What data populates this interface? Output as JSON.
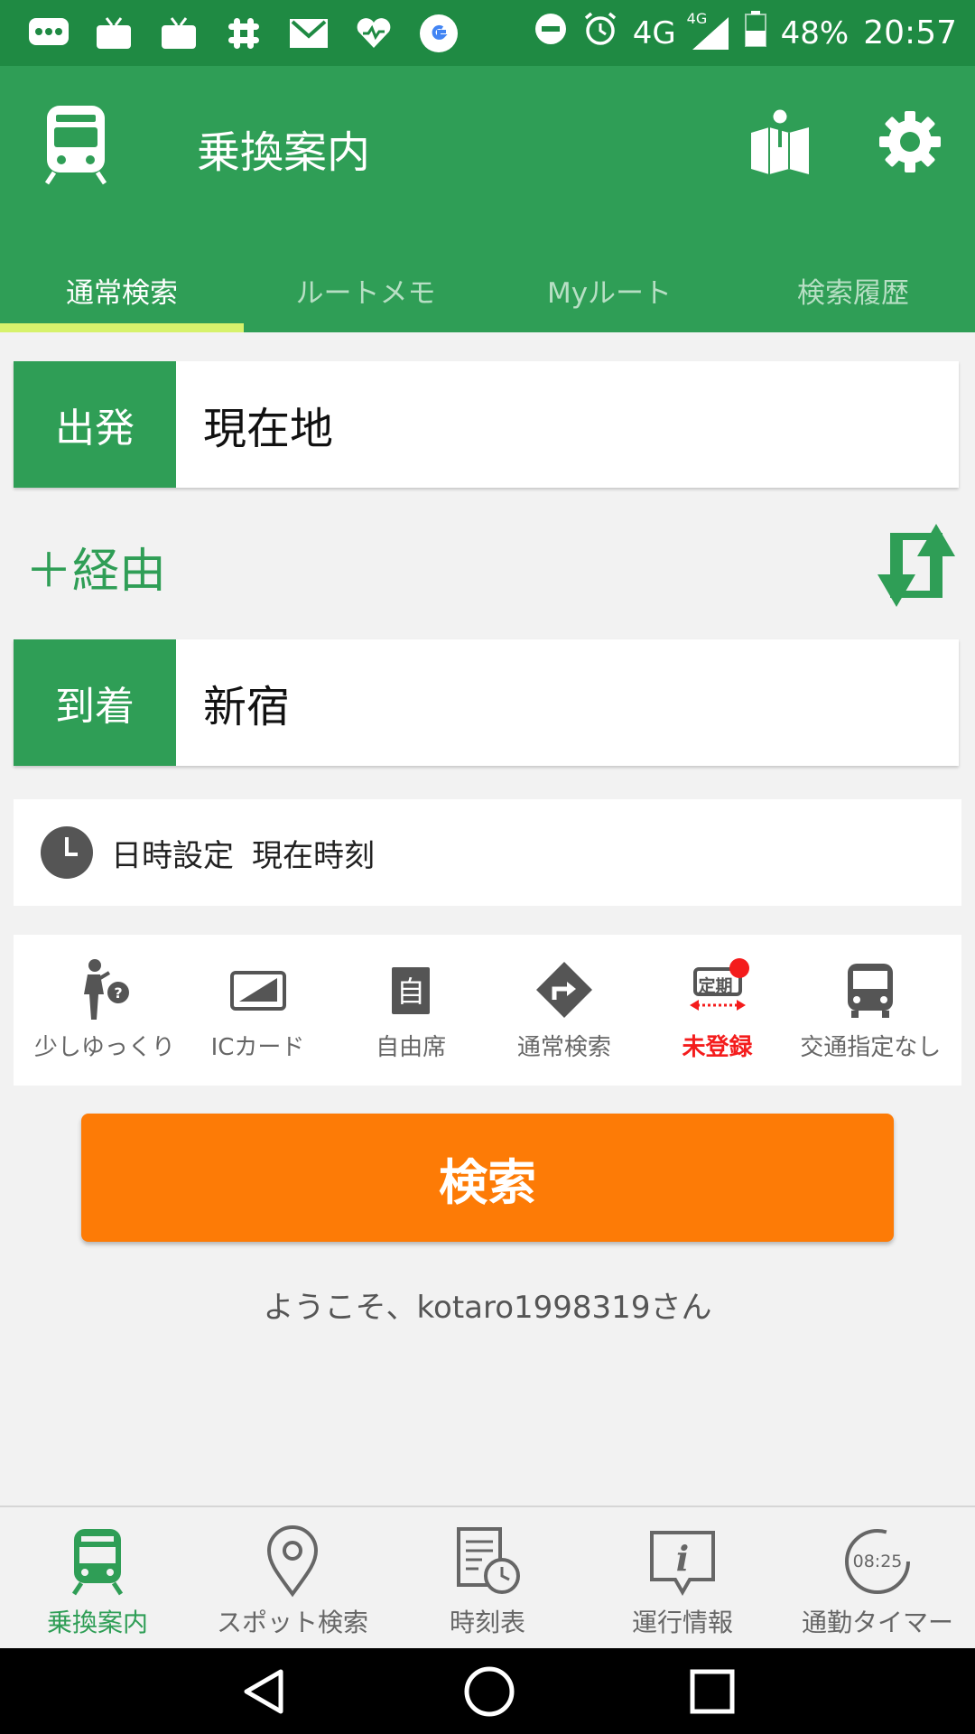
{
  "status_bar": {
    "network": "4G",
    "network_small": "4G",
    "battery": "48%",
    "time": "20:57",
    "icons": [
      "messages-icon",
      "tv-icon",
      "tv-icon",
      "slack-icon",
      "gmail-icon",
      "heart-icon",
      "google-icon",
      "dnd-icon",
      "alarm-icon",
      "signal-icon",
      "battery-icon"
    ]
  },
  "app_bar": {
    "title": "乗換案内",
    "tabs": [
      {
        "label": "通常検索",
        "active": true
      },
      {
        "label": "ルートメモ",
        "active": false
      },
      {
        "label": "Myルート",
        "active": false
      },
      {
        "label": "検索履歴",
        "active": false
      }
    ]
  },
  "form": {
    "departure_label": "出発",
    "departure_value": "現在地",
    "via_label": "＋経由",
    "arrival_label": "到着",
    "arrival_value": "新宿",
    "datetime_label": "日時設定",
    "datetime_value": "現在時刻"
  },
  "options": [
    {
      "label": "少しゆっくり",
      "icon": "walking-pace-icon"
    },
    {
      "label": "ICカード",
      "icon": "ic-card-icon"
    },
    {
      "label": "自由席",
      "icon": "seat-icon"
    },
    {
      "label": "通常検索",
      "icon": "route-direction-icon"
    },
    {
      "label": "未登録",
      "icon": "commuter-pass-icon",
      "badge_text": "定期",
      "alert": true
    },
    {
      "label": "交通指定なし",
      "icon": "bus-icon"
    }
  ],
  "search_button": "検索",
  "welcome": "ようこそ、kotaro1998319さん",
  "bottom_nav": [
    {
      "label": "乗換案内",
      "active": true
    },
    {
      "label": "スポット検索",
      "active": false
    },
    {
      "label": "時刻表",
      "active": false
    },
    {
      "label": "運行情報",
      "active": false
    },
    {
      "label": "通勤タイマー",
      "active": false,
      "clock_text": "08:25"
    }
  ],
  "colors": {
    "primary": "#2f9e56",
    "status_bar": "#1f8a43",
    "accent_tab": "#d7f26c",
    "search_button": "#fd7b06",
    "alert": "#f41c1c"
  }
}
